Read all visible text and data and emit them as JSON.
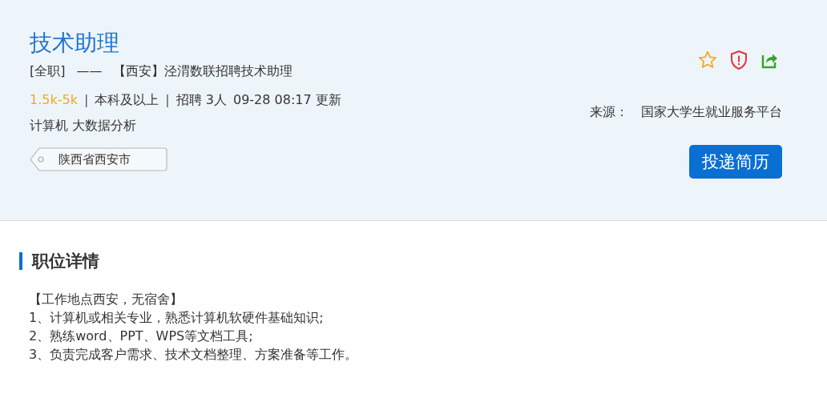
{
  "job": {
    "title": "技术助理",
    "type": "[全职]",
    "dash": "——",
    "subtitle": "【西安】泾渭数联招聘技术助理",
    "meta": [
      {
        "kind": "salary",
        "text": "1.5k-5k"
      },
      {
        "kind": "sep",
        "text": "|"
      },
      {
        "kind": "plain",
        "text": "本科及以上"
      },
      {
        "kind": "sep",
        "text": "|"
      },
      {
        "kind": "plain",
        "text": "招聘 3人"
      },
      {
        "kind": "plain",
        "text": "09-28 08:17 更新"
      }
    ],
    "major": "计算机 大数据分析",
    "location_tag": "陕西省西安市",
    "source_label": "来源：",
    "source": "国家大学生就业服务平台",
    "apply_button": "投递简历"
  },
  "details": {
    "heading": "职位详情",
    "lines": [
      "【工作地点西安，无宿舍】",
      "1、计算机或相关专业，熟悉计算机软硬件基础知识;",
      "2、熟练word、PPT、WPS等文档工具;",
      "3、负责完成客户需求、技术文档整理、方案准备等工作。"
    ]
  }
}
